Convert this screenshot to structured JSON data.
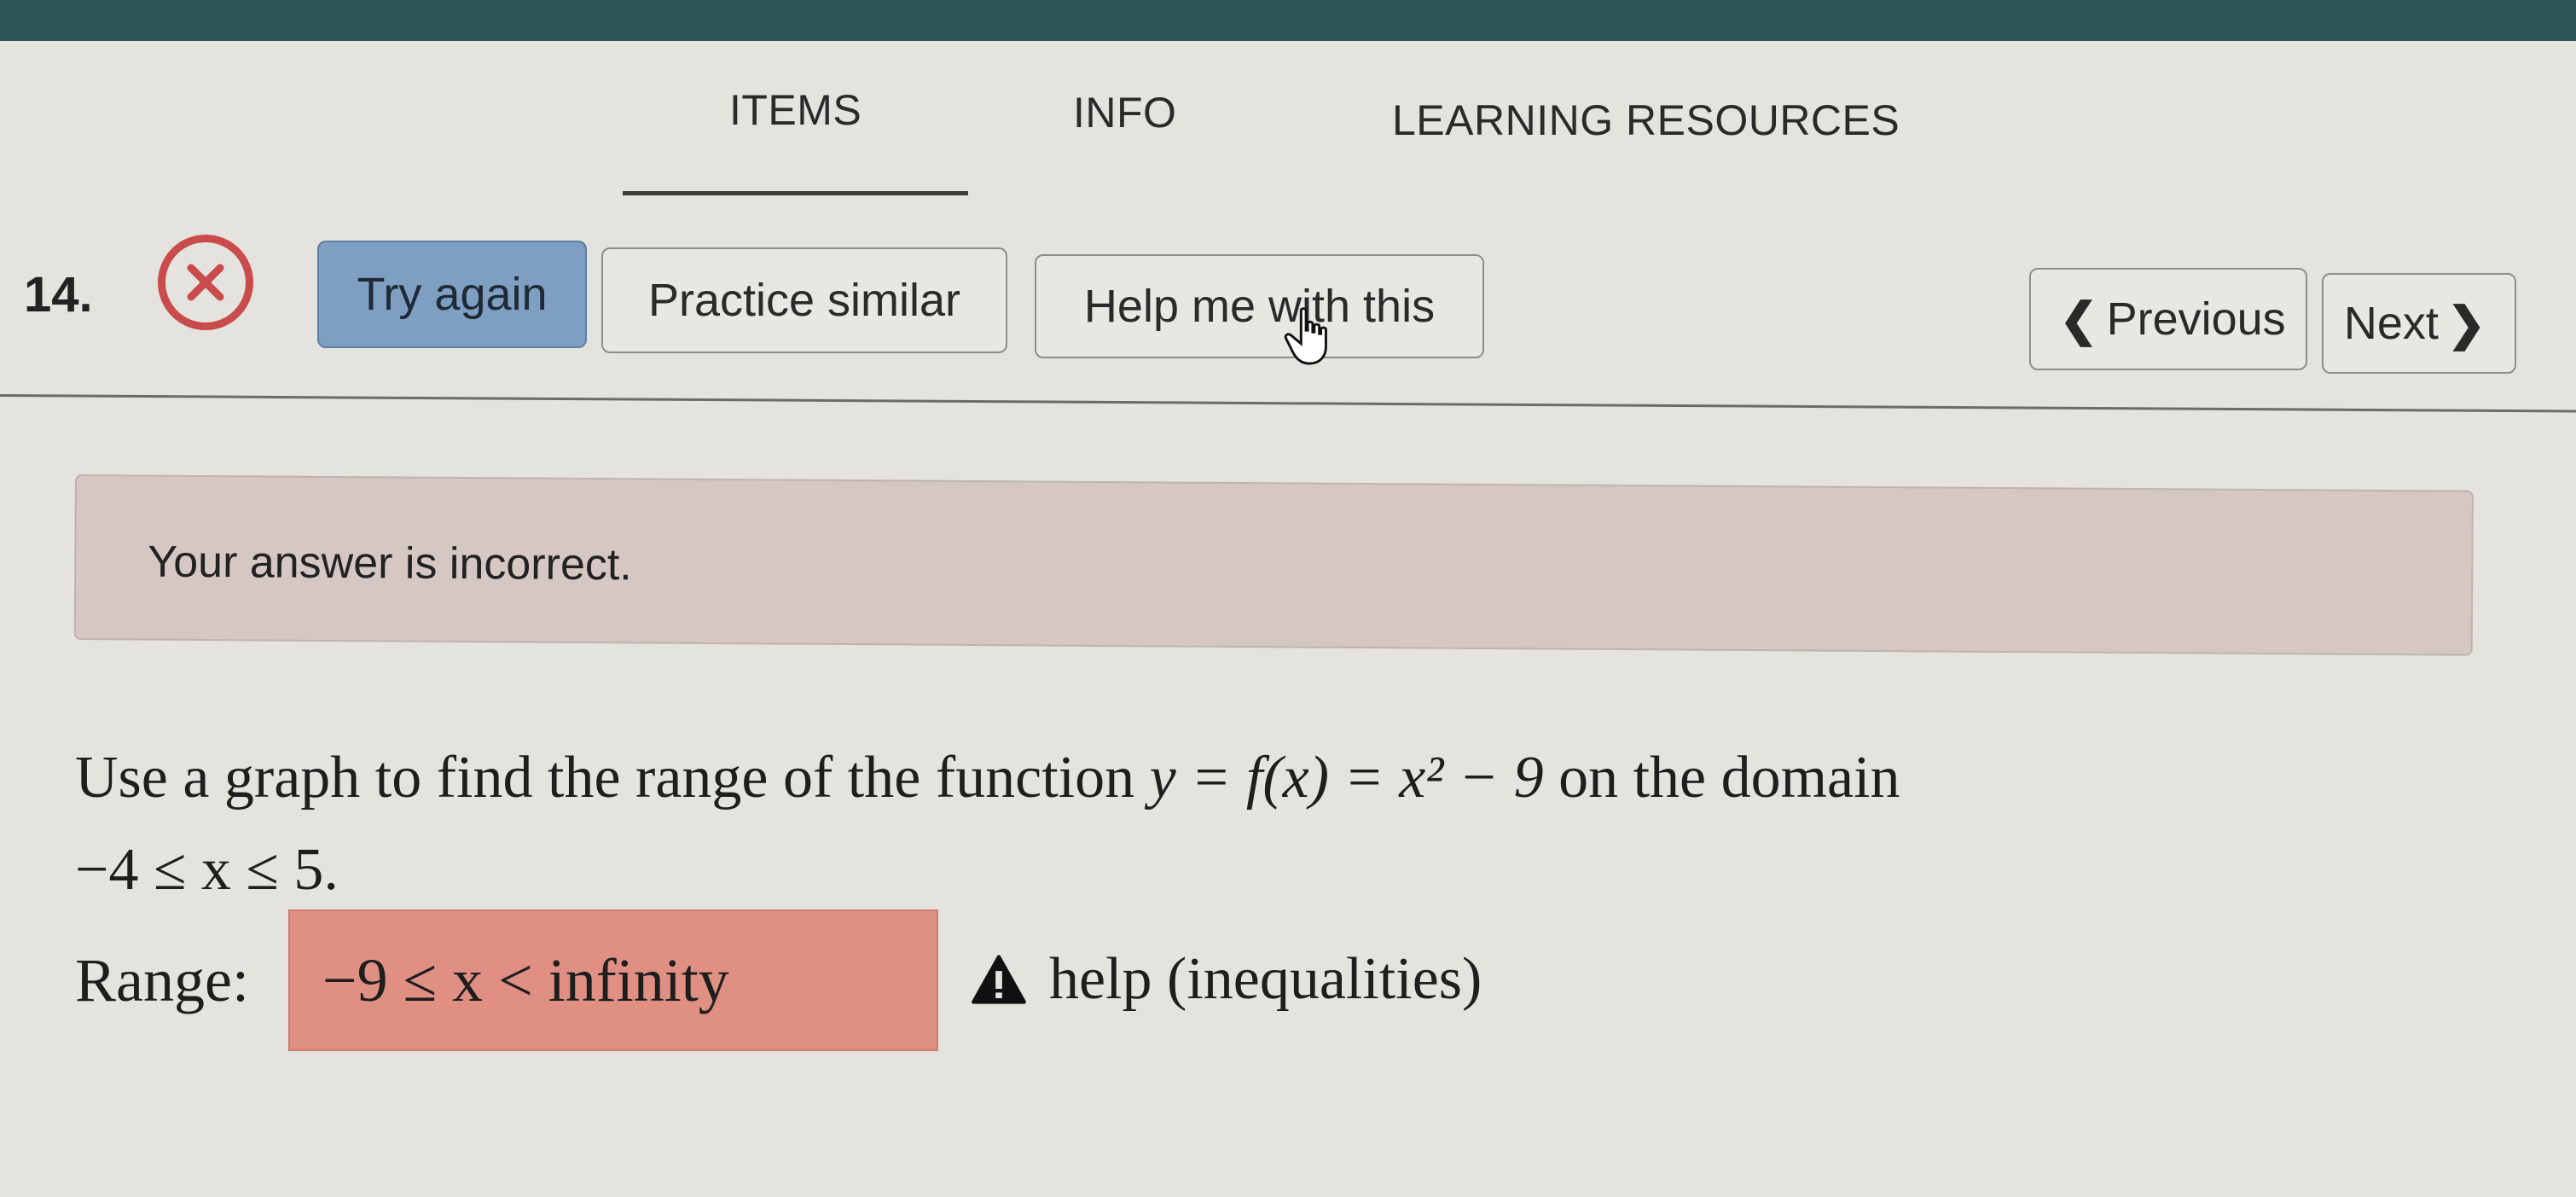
{
  "tabs": {
    "items": "ITEMS",
    "info": "INFO",
    "learning_resources": "LEARNING RESOURCES"
  },
  "question_number": "14.",
  "status": {
    "icon": "x-circle-icon",
    "state": "incorrect",
    "color": "#c94b4b"
  },
  "buttons": {
    "try_again": "Try again",
    "practice_similar": "Practice similar",
    "help_me": "Help me with this",
    "previous": "Previous",
    "next": "Next"
  },
  "feedback": {
    "text": "Your answer is incorrect."
  },
  "question": {
    "text_before": "Use a graph to find the range of the function ",
    "function": "y = f(x) = x² − 9",
    "text_after": " on the domain",
    "domain": "−4 ≤ x ≤ 5."
  },
  "answer": {
    "label": "Range:",
    "value": "−9 ≤ x < infinity",
    "help_label": "help (inequalities)"
  },
  "colors": {
    "accent_button": "#7e9ec2",
    "incorrect_answer_bg": "#e08f83",
    "feedback_bg": "#d5c8c4"
  }
}
